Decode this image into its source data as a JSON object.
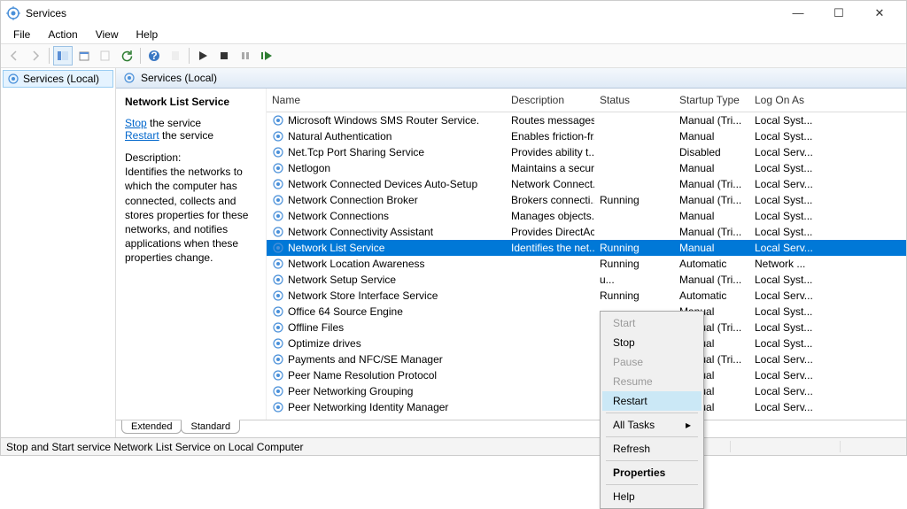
{
  "title": "Services",
  "menu": {
    "file": "File",
    "action": "Action",
    "view": "View",
    "help": "Help"
  },
  "nav": {
    "root": "Services (Local)"
  },
  "mainHeader": "Services (Local)",
  "detail": {
    "selectedName": "Network List Service",
    "stopLabel": "Stop",
    "stopSuffix": " the service",
    "restartLabel": "Restart",
    "restartSuffix": " the service",
    "descLabel": "Description:",
    "descText": "Identifies the networks to which the computer has connected, collects and stores properties for these networks, and notifies applications when these properties change."
  },
  "columns": {
    "name": "Name",
    "desc": "Description",
    "status": "Status",
    "startup": "Startup Type",
    "logon": "Log On As"
  },
  "services": [
    {
      "name": "Microsoft Windows SMS Router Service.",
      "desc": "Routes messages...",
      "status": "",
      "startup": "Manual (Tri...",
      "logon": "Local Syst..."
    },
    {
      "name": "Natural Authentication",
      "desc": "Enables friction-fr...",
      "status": "",
      "startup": "Manual",
      "logon": "Local Syst..."
    },
    {
      "name": "Net.Tcp Port Sharing Service",
      "desc": "Provides ability t...",
      "status": "",
      "startup": "Disabled",
      "logon": "Local Serv..."
    },
    {
      "name": "Netlogon",
      "desc": "Maintains a secur...",
      "status": "",
      "startup": "Manual",
      "logon": "Local Syst..."
    },
    {
      "name": "Network Connected Devices Auto-Setup",
      "desc": "Network Connect...",
      "status": "",
      "startup": "Manual (Tri...",
      "logon": "Local Serv..."
    },
    {
      "name": "Network Connection Broker",
      "desc": "Brokers connecti...",
      "status": "Running",
      "startup": "Manual (Tri...",
      "logon": "Local Syst..."
    },
    {
      "name": "Network Connections",
      "desc": "Manages objects...",
      "status": "",
      "startup": "Manual",
      "logon": "Local Syst..."
    },
    {
      "name": "Network Connectivity Assistant",
      "desc": "Provides DirectAc...",
      "status": "",
      "startup": "Manual (Tri...",
      "logon": "Local Syst..."
    },
    {
      "name": "Network List Service",
      "desc": "Identifies the net...",
      "status": "Running",
      "startup": "Manual",
      "logon": "Local Serv...",
      "selected": true
    },
    {
      "name": "Network Location Awareness",
      "desc": "",
      "status": "Running",
      "startup": "Automatic",
      "logon": "Network ..."
    },
    {
      "name": "Network Setup Service",
      "desc": "",
      "status": "u...",
      "startup": "Manual (Tri...",
      "logon": "Local Syst..."
    },
    {
      "name": "Network Store Interface Service",
      "desc": "",
      "status": "Running",
      "startup": "Automatic",
      "logon": "Local Serv..."
    },
    {
      "name": "Office 64 Source Engine",
      "desc": "",
      "status": "",
      "startup": "Manual",
      "logon": "Local Syst..."
    },
    {
      "name": "Offline Files",
      "desc": "",
      "status": "",
      "startup": "Manual (Tri...",
      "logon": "Local Syst..."
    },
    {
      "name": "Optimize drives",
      "desc": "",
      "status": "",
      "startup": "Manual",
      "logon": "Local Syst..."
    },
    {
      "name": "Payments and NFC/SE Manager",
      "desc": "",
      "status": "",
      "startup": "Manual (Tri...",
      "logon": "Local Serv..."
    },
    {
      "name": "Peer Name Resolution Protocol",
      "desc": "",
      "status": "",
      "startup": "Manual",
      "logon": "Local Serv..."
    },
    {
      "name": "Peer Networking Grouping",
      "desc": "",
      "status": "",
      "startup": "Manual",
      "logon": "Local Serv..."
    },
    {
      "name": "Peer Networking Identity Manager",
      "desc": "",
      "status": "",
      "startup": "Manual",
      "logon": "Local Serv..."
    }
  ],
  "contextMenu": {
    "start": "Start",
    "stop": "Stop",
    "pause": "Pause",
    "resume": "Resume",
    "restart": "Restart",
    "allTasks": "All Tasks",
    "refresh": "Refresh",
    "properties": "Properties",
    "help": "Help"
  },
  "tabs": {
    "extended": "Extended",
    "standard": "Standard"
  },
  "status": "Stop and Start service Network List Service on Local Computer"
}
